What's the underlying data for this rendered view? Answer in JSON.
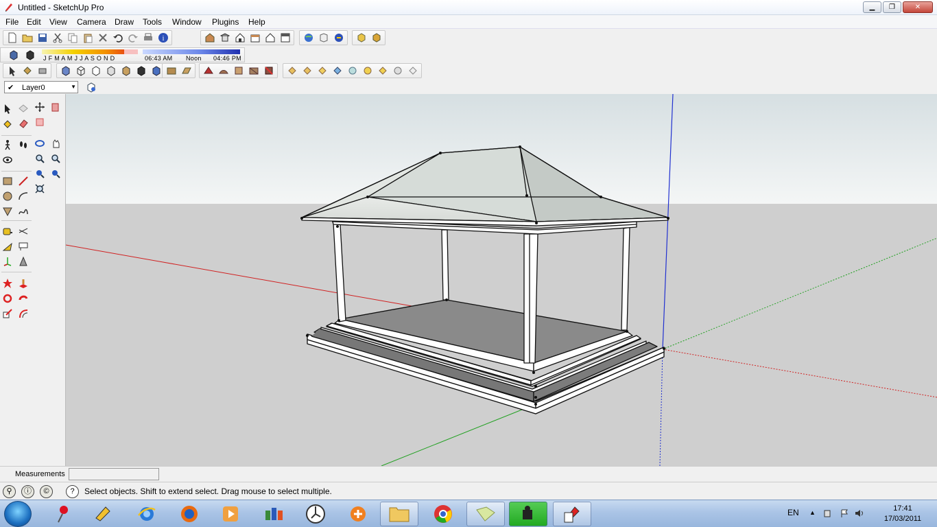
{
  "window": {
    "title": "Untitled - SketchUp Pro",
    "minimize": "▁",
    "maximize": "❐",
    "close": "✕"
  },
  "menu": [
    "File",
    "Edit",
    "View",
    "Camera",
    "Draw",
    "Tools",
    "Window",
    "Plugins",
    "Help"
  ],
  "shadow": {
    "months": "J  F  M  A  M  J  J  A  S  O  N  D",
    "time_start": "06:43 AM",
    "time_mid": "Noon",
    "time_end": "04:46 PM"
  },
  "layer": {
    "name": "Layer0",
    "checked": "✔"
  },
  "measurements": {
    "label": "Measurements",
    "value": ""
  },
  "status": {
    "message": "Select objects. Shift to extend select. Drag mouse to select multiple."
  },
  "taskbar": {
    "language": "EN",
    "time": "17:41",
    "date": "17/03/2011"
  },
  "colors": {
    "axis_red": "#d02020",
    "axis_green": "#20a020",
    "axis_blue": "#2030d0",
    "sky_top": "#dce3e6",
    "ground": "#cfcfcf"
  },
  "icons": {
    "toolbar1": [
      "new-icon",
      "open-icon",
      "save-icon",
      "cut-icon",
      "copy-icon",
      "paste-icon",
      "erase-icon",
      "undo-icon",
      "redo-icon",
      "print-icon",
      "model-info-icon",
      "iso-view-icon",
      "top-view-icon",
      "front-view-icon",
      "right-view-icon",
      "back-view-icon",
      "left-view-icon",
      "get-models-icon",
      "share-model-icon",
      "google-earth-icon",
      "components-icon",
      "plugin-icon"
    ],
    "toolbar3": [
      "select-icon",
      "paint-icon",
      "eraser-icon",
      "xray-icon",
      "wireframe-icon",
      "hidden-line-icon",
      "shaded-icon",
      "shaded-texture-icon",
      "monochrome-icon",
      "section-plane-icon",
      "section-display-icon",
      "section-cut-icon",
      "sandbox-a-icon",
      "sandbox-b-icon",
      "sandbox-c-icon",
      "sandbox-d-icon",
      "sandbox-e-icon",
      "sandbox-f-icon",
      "sandbox-g-icon",
      "sandbox-h-icon",
      "sandbox-i-icon",
      "sandbox-j-icon",
      "sandbox-k-icon",
      "sandbox-l-icon"
    ]
  }
}
